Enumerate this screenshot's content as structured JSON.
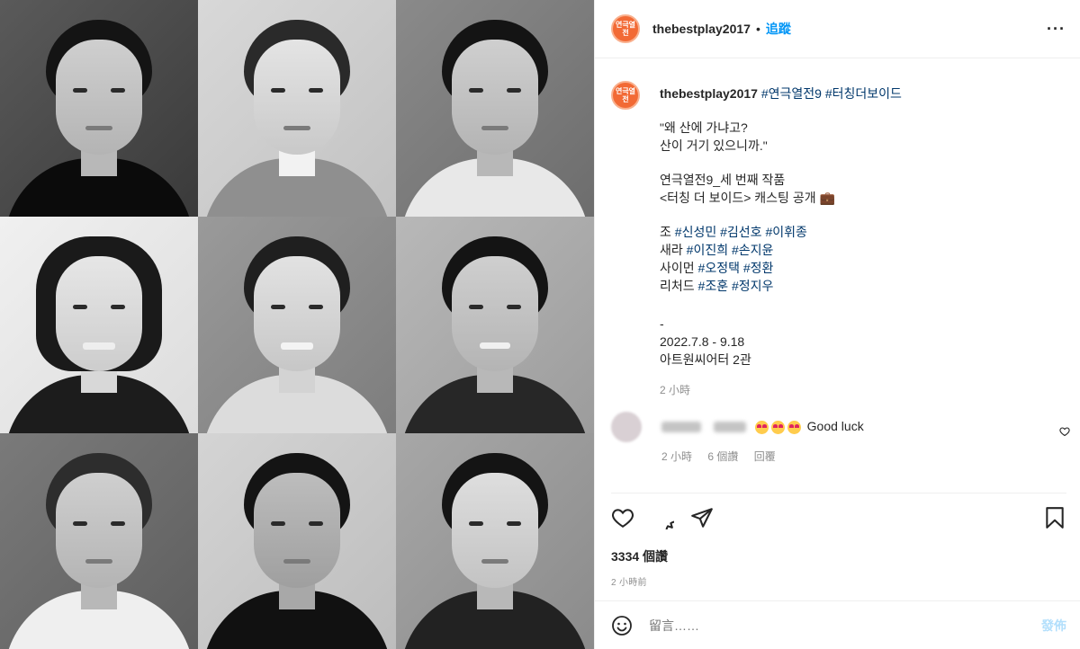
{
  "header": {
    "username": "thebestplay2017",
    "separator": "•",
    "follow_label": "追蹤",
    "more_label": "···",
    "avatar_text": "연극열전"
  },
  "caption": {
    "username": "thebestplay2017",
    "hashtags": [
      "#연극열전9",
      "#터칭더보이드"
    ],
    "quote_line1": "\"왜 산에 가냐고?",
    "quote_line2": "산이 거기 있으니까.\"",
    "work_line1": "연극열전9_세 번째 작품",
    "work_line2": "<터칭 더 보이드> 캐스팅 공개 💼",
    "cast": [
      {
        "role": "조",
        "names": [
          "#신성민",
          "#김선호",
          "#이휘종"
        ]
      },
      {
        "role": "새라",
        "names": [
          "#이진희",
          "#손지윤"
        ]
      },
      {
        "role": "사이먼",
        "names": [
          "#오정택",
          "#정환"
        ]
      },
      {
        "role": "리처드",
        "names": [
          "#조훈",
          "#정지우"
        ]
      }
    ],
    "dash": "-",
    "dates": "2022.7.8 - 9.18",
    "venue": "아트원씨어터 2관",
    "time": "2 小時"
  },
  "comment": {
    "text": "Good luck",
    "time": "2 小時",
    "likes": "6 個讚",
    "reply": "回覆"
  },
  "actions": {
    "likes_count": "3334 個讚",
    "posted_ago": "2 小時前"
  },
  "add_comment": {
    "placeholder": "留言……",
    "post_label": "發佈"
  },
  "colors": {
    "link": "#00376b",
    "follow": "#0095f6",
    "post_disabled": "#b2dffc",
    "avatar": "#f26a35"
  },
  "photos": [
    {
      "icon": "portrait-photo-1"
    },
    {
      "icon": "portrait-photo-2"
    },
    {
      "icon": "portrait-photo-3"
    },
    {
      "icon": "portrait-photo-4"
    },
    {
      "icon": "portrait-photo-5"
    },
    {
      "icon": "portrait-photo-6"
    },
    {
      "icon": "portrait-photo-7"
    },
    {
      "icon": "portrait-photo-8"
    },
    {
      "icon": "portrait-photo-9"
    }
  ]
}
